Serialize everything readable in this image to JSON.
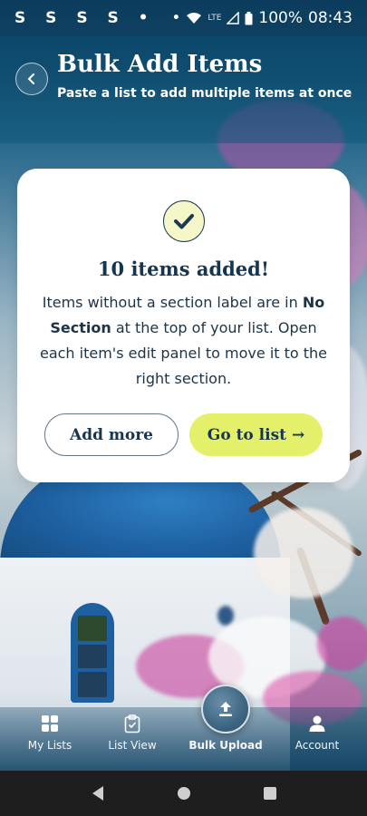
{
  "status_bar": {
    "left_icons": "S S S S •",
    "dot": "•",
    "network": "LTE",
    "battery": "100%",
    "time": "08:43"
  },
  "header": {
    "title": "Bulk Add Items",
    "subtitle": "Paste a list to add multiple items at once"
  },
  "card": {
    "title": "10 items added!",
    "body_part1": "Items without a section label are in ",
    "body_bold": "No Section",
    "body_part2": " at the top of your list. Open each item's edit panel to move it to the right section.",
    "add_more_label": "Add more",
    "go_to_list_label": "Go to list →"
  },
  "bottom_nav": {
    "items": [
      {
        "label": "My Lists",
        "icon": "grid-icon"
      },
      {
        "label": "List View",
        "icon": "clipboard-check-icon"
      },
      {
        "label": "Bulk Upload",
        "icon": "upload-icon",
        "active": true
      },
      {
        "label": "Account",
        "icon": "person-icon"
      }
    ]
  },
  "colors": {
    "primary_button": "#e4ef6a",
    "text_dark": "#163650",
    "check_bg": "#f6f7c8"
  }
}
